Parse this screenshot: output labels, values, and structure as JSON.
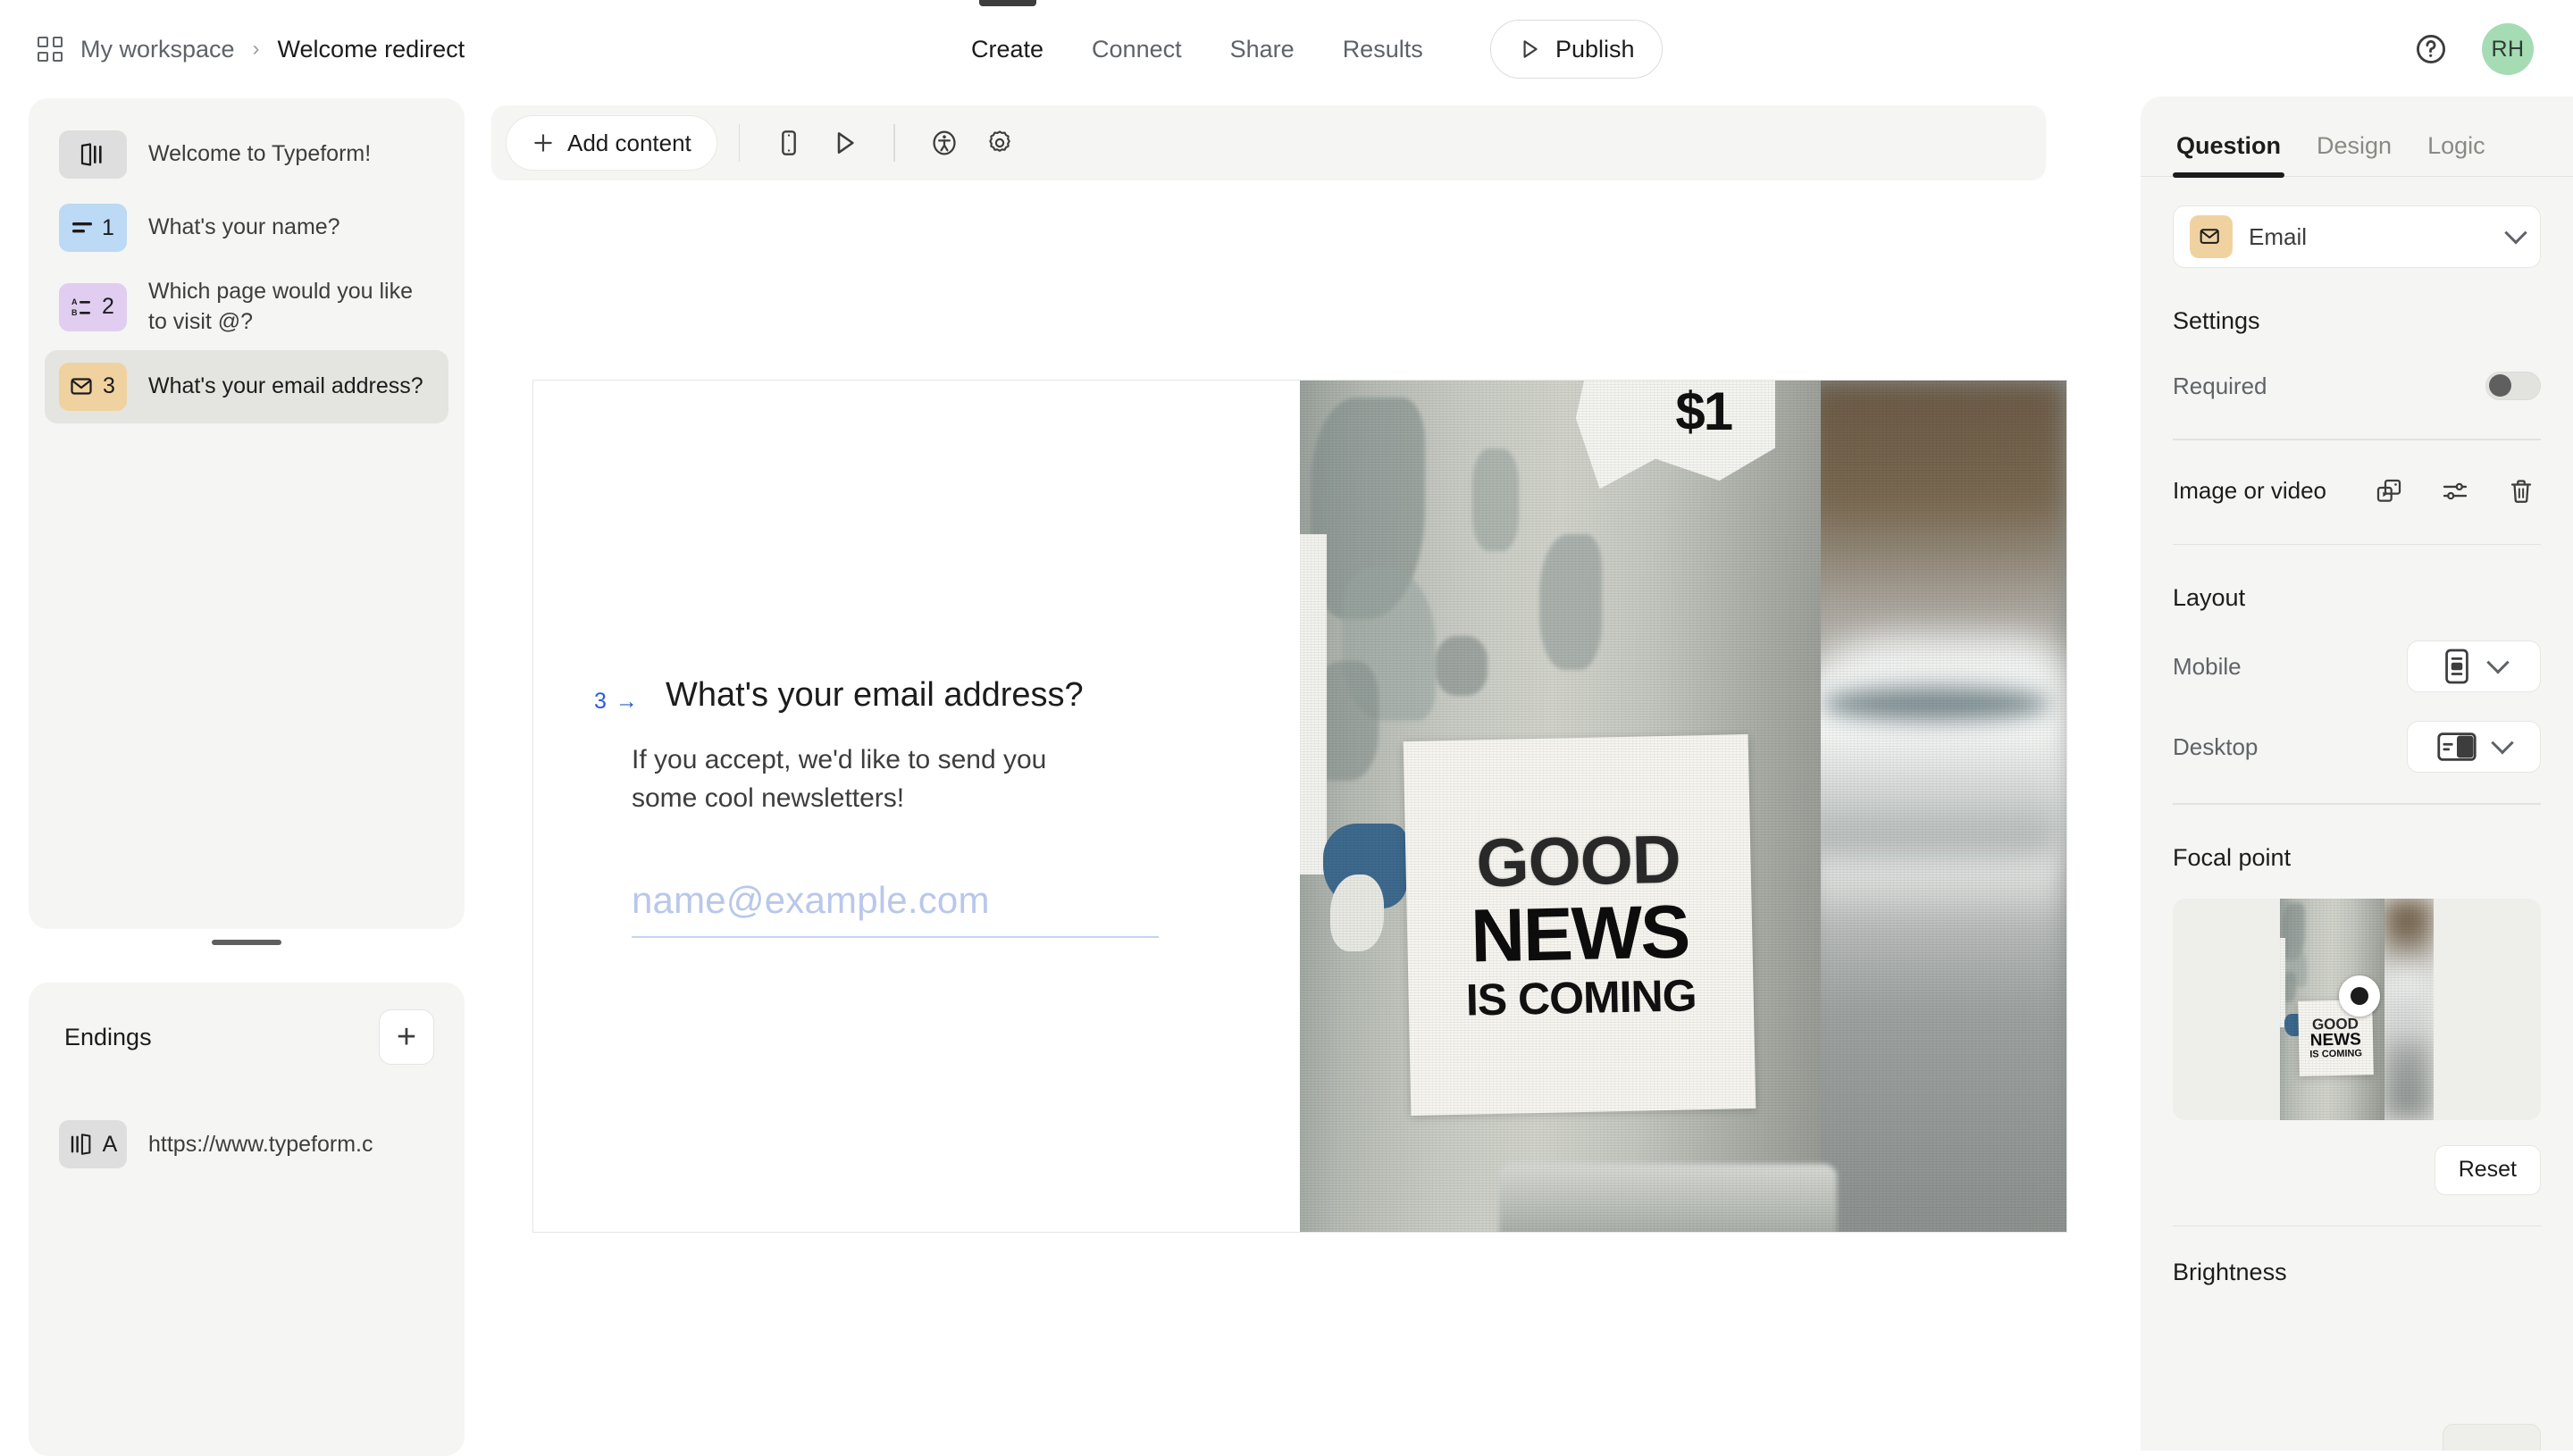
{
  "header": {
    "workspace": "My workspace",
    "separator": "›",
    "form_title": "Welcome redirect",
    "tabs": [
      {
        "label": "Create",
        "active": true
      },
      {
        "label": "Connect",
        "active": false
      },
      {
        "label": "Share",
        "active": false
      },
      {
        "label": "Results",
        "active": false
      }
    ],
    "publish_label": "Publish",
    "avatar_initials": "RH"
  },
  "sidebar": {
    "questions": [
      {
        "label": "Welcome to Typeform!",
        "num": "",
        "badge_color": "#dedede",
        "icon": "welcome-screen-icon",
        "selected": false
      },
      {
        "label": "What's your name?",
        "num": "1",
        "badge_color": "#bcd9f5",
        "icon": "short-text-icon",
        "selected": false
      },
      {
        "label": "Which page would you like to visit @?",
        "num": "2",
        "badge_color": "#e0cdf0",
        "icon": "multiple-choice-icon",
        "selected": false
      },
      {
        "label": "What's your email address?",
        "num": "3",
        "badge_color": "#f0d2a0",
        "icon": "email-icon",
        "selected": true
      }
    ],
    "endings": {
      "title": "Endings",
      "add_label": "+",
      "items": [
        {
          "letter": "A",
          "label": "https://www.typeform.c",
          "icon": "ending-screen-icon"
        }
      ]
    }
  },
  "toolbar": {
    "add_content_label": "Add content",
    "add_content_plus": "+",
    "icons": [
      "mobile-preview-icon",
      "preview-play-icon",
      "accessibility-icon",
      "settings-gear-icon"
    ]
  },
  "canvas": {
    "question_number": "3",
    "question_arrow": "→",
    "question_title": "What's your email address?",
    "question_description": "If you accept, we'd like to send you some cool newsletters!",
    "input_placeholder": "name@example.com",
    "image": {
      "poster_line1": "GOOD",
      "poster_line2": "NEWS",
      "poster_line3": "IS COMING",
      "top_poster_text": "$1"
    }
  },
  "right_panel": {
    "tabs": [
      {
        "label": "Question",
        "active": true
      },
      {
        "label": "Design",
        "active": false
      },
      {
        "label": "Logic",
        "active": false
      }
    ],
    "question_type": "Email",
    "settings": {
      "title": "Settings",
      "required_label": "Required",
      "required_on": false
    },
    "image_or_video": {
      "label": "Image or video",
      "icons": [
        "replace-media-icon",
        "adjust-settings-icon",
        "delete-trash-icon"
      ]
    },
    "layout": {
      "title": "Layout",
      "mobile_label": "Mobile",
      "desktop_label": "Desktop"
    },
    "focal_point": {
      "title": "Focal point",
      "reset_label": "Reset"
    },
    "brightness": {
      "title": "Brightness"
    }
  },
  "colors": {
    "accent_blue": "#2b5cd6",
    "avatar_green": "#a5dcb4",
    "panel_bg": "#f5f5f3",
    "selected_bg": "#e4e4e1"
  }
}
